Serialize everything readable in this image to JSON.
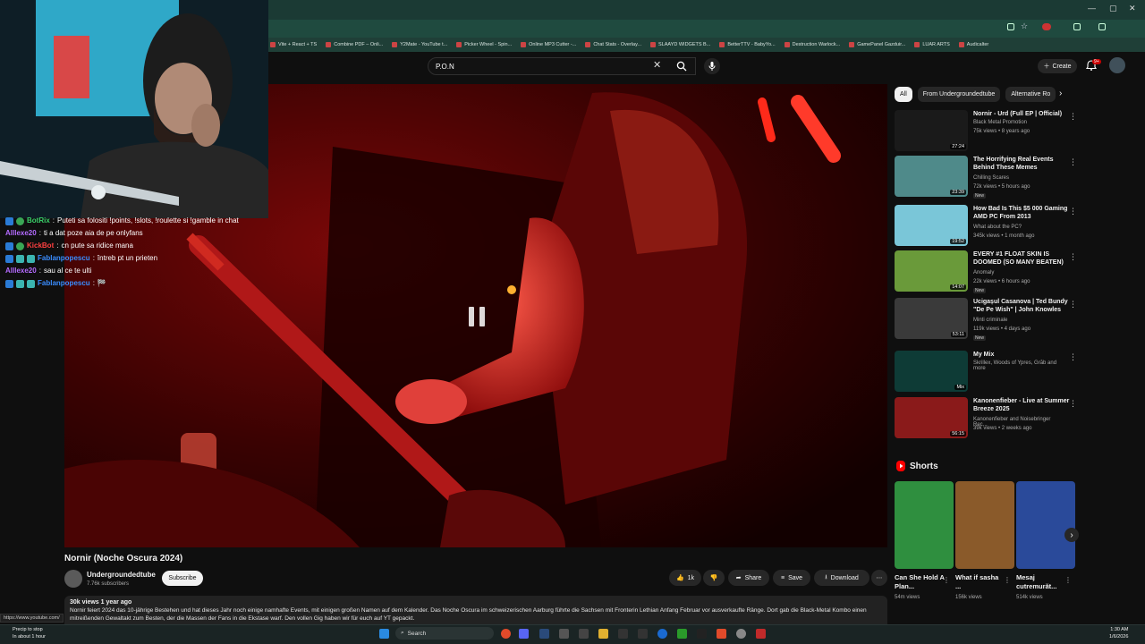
{
  "bookmarks": [
    "Vite + React + TS",
    "Combine PDF – Onli...",
    "Y2Mate - YouTube t...",
    "Picker Wheel - Spin...",
    "Online MP3 Cutter -...",
    "Chat Stats - Overlay...",
    "SLAAYD WIDGETS B...",
    "BetterTTV - BabyYo...",
    "Destruction Warlock...",
    "GamePanel Gazduir...",
    "LUAR ARTS",
    "Audicalter"
  ],
  "search": {
    "query": "P.O.N"
  },
  "header": {
    "create_label": "Create",
    "notif_count": "9+"
  },
  "chat": [
    {
      "user": "BotRix",
      "msg": "Puteti sa folositi !points, !slots, !roulette si !gamble in chat",
      "user_color": "#3ad16a",
      "badges": [
        "blue",
        "green"
      ]
    },
    {
      "user": "Alllexe20",
      "msg": "ti a dat poze aia de pe onlyfans",
      "user_color": "#b46bff",
      "badges": []
    },
    {
      "user": "KickBot",
      "msg": "cn pute sa ridice mana",
      "user_color": "#ff4040",
      "badges": [
        "blue",
        "green"
      ]
    },
    {
      "user": "Fablanpopescu",
      "msg": "întreb pt un prieten",
      "user_color": "#3a8dff",
      "badges": [
        "blue",
        "cyan",
        "mod"
      ]
    },
    {
      "user": "Alllexe20",
      "msg": "sau al ce te ulti",
      "user_color": "#b46bff",
      "badges": []
    },
    {
      "user": "Fablanpopescu",
      "msg": "🏁",
      "user_color": "#3a8dff",
      "badges": [
        "blue",
        "cyan",
        "mod"
      ]
    }
  ],
  "video": {
    "title": "Nornir (Noche Oscura 2024)",
    "channel": "Undergroundedtube",
    "subscribers": "7.76k subscribers",
    "subscribe_label": "Subscribe",
    "likes": "1k",
    "share_label": "Share",
    "save_label": "Save",
    "download_label": "Download",
    "views_age": "30k views  1 year ago",
    "description": "Nornir feiert 2024 das 10-jährige Bestehen und hat dieses Jahr noch einige namhafte Events, mit einigen großen Namen auf dem Kalender. Das Noche Oscura im schweizerischen Aarburg führte die Sachsen mit Fronterin Lethian Anfang Februar vor ausverkaufte Ränge. Dort gab die Black-Metal Kombo einen mitreißenden Gewaltakt zum Besten, der die Massen der Fans in die Ekstase warf. Den vollen Gig haben wir für euch auf YT gepackt."
  },
  "chips": [
    "All",
    "From Undergroundedtube",
    "Alternative Ro"
  ],
  "recommendations": [
    {
      "title": "Nornir - Urd (Full EP | Official)",
      "channel": "Black Metal Promotion",
      "meta": "75k views • 8 years ago",
      "duration": "27:24",
      "new": "",
      "thumb": "#1a1a1a"
    },
    {
      "title": "The Horrifying Real Events Behind These Memes",
      "channel": "Chilling Scares",
      "meta": "72k views • 5 hours ago",
      "duration": "23:39",
      "new": "New",
      "thumb": "#4f8a8a"
    },
    {
      "title": "How Bad Is This $5 000 Gaming AMD PC From 2013",
      "channel": "What about the PC?",
      "meta": "345k views • 1 month ago",
      "duration": "19:52",
      "new": "",
      "thumb": "#7ac6d8"
    },
    {
      "title": "EVERY #1 FLOAT SKIN IS DOOMED (SO MANY BEATEN)",
      "channel": "Anomaly",
      "meta": "22k views • 6 hours ago",
      "duration": "14:07",
      "new": "New",
      "thumb": "#6a9a3a"
    },
    {
      "title": "Ucigașul Casanova | Ted Bundy \"De Pe Wish\" | John Knowles",
      "channel": "Minti criminale",
      "meta": "119k views • 4 days ago",
      "duration": "53:11",
      "new": "New",
      "thumb": "#3a3a3a"
    },
    {
      "title": "My Mix",
      "channel": "Skrillex, Woods of Ypres, Grăb and more",
      "meta": "",
      "duration": "Mix",
      "new": "",
      "thumb": "#0e3b36"
    },
    {
      "title": "Kanonenfieber - Live at Summer Breeze 2025",
      "channel": "Kanonenfieber and Noisebringer Rec...",
      "meta": "39k views • 2 weeks ago",
      "duration": "56:15",
      "new": "",
      "thumb": "#8a1a1a"
    }
  ],
  "shorts_label": "Shorts",
  "shorts": [
    {
      "title": "Can She Hold A Plan...",
      "views": "54m views",
      "thumb": "#2f8f3f"
    },
    {
      "title": "What if sasha ...",
      "views": "156k views",
      "thumb": "#8a5a2a"
    },
    {
      "title": "Mesaj cutremurăt...",
      "views": "514k views",
      "thumb": "#2a4a9a"
    }
  ],
  "status_url": "https://www.youtube.com/",
  "taskbar": {
    "search_label": "Search",
    "time": "1:30 AM",
    "date": "1/6/2026",
    "weather_title": "Precip to stop",
    "weather_sub": "In about 1 hour"
  },
  "colors": {
    "accent_red": "#ff0000",
    "bg": "#0f0f0f",
    "chrome_green": "#1f4a3f"
  }
}
